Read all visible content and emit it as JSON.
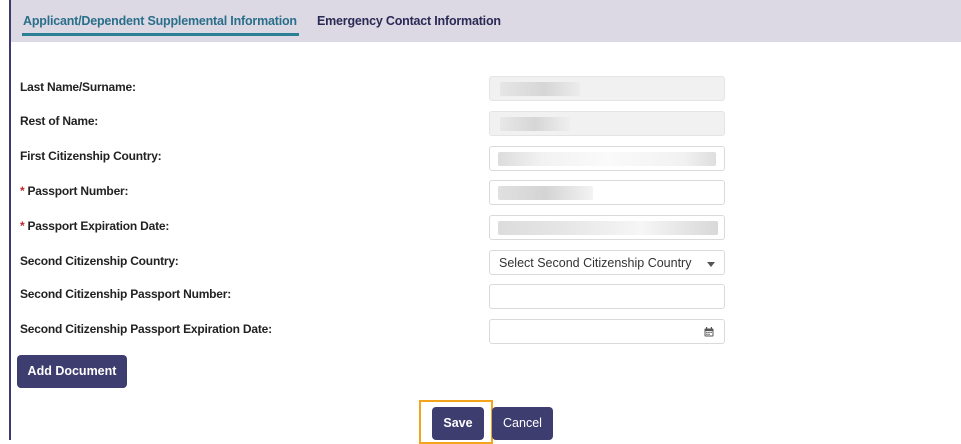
{
  "tabs": {
    "active_label": "Applicant/Dependent Supplemental Information",
    "inactive_label": "Emergency Contact Information"
  },
  "form": {
    "last_name_label": "Last Name/Surname:",
    "rest_of_name_label": "Rest of Name:",
    "first_citizenship_label": "First Citizenship Country:",
    "passport_number_label": "Passport Number:",
    "passport_expiration_label": "Passport Expiration Date:",
    "second_citizenship_label": "Second Citizenship Country:",
    "second_citizenship_select_value": "Select Second Citizenship Country",
    "second_passport_number_label": "Second Citizenship Passport Number:",
    "second_passport_expiration_label": "Second Citizenship Passport Expiration Date:",
    "required_marker": "*"
  },
  "buttons": {
    "add_document": "Add Document",
    "save": "Save",
    "cancel": "Cancel"
  },
  "colors": {
    "brand_button": "#3e3d70",
    "active_tab": "#2a6f8a",
    "required": "#c0272d",
    "highlight": "#f2a51a"
  },
  "icons": {
    "date_picker": "calendar-icon",
    "select_caret": "chevron-down-icon"
  }
}
